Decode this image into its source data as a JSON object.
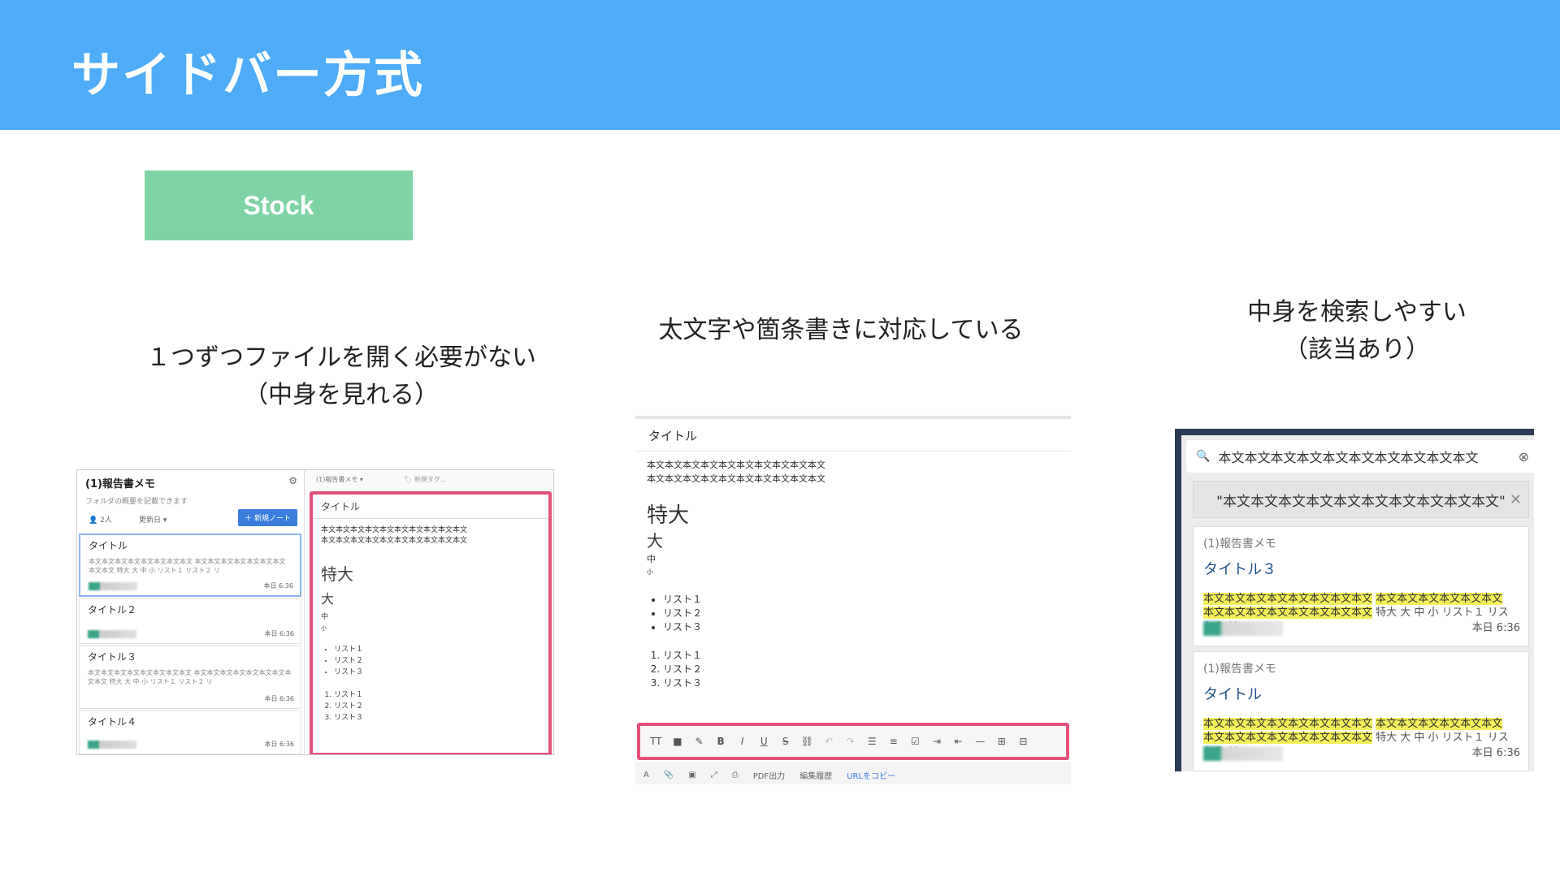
{
  "header": {
    "title": "サイドバー方式"
  },
  "stock_label": "Stock",
  "captions": {
    "c1_line1": "１つずつファイルを開く必要がない",
    "c1_line2": "（中身を見れる）",
    "c2": "太文字や箇条書きに対応している",
    "c3_line1": "中身を検索しやすい",
    "c3_line2": "（該当あり）"
  },
  "panel1": {
    "folder": "(1)報告書メモ",
    "folder_desc": "フォルダの概要を記載できます",
    "members": "2人",
    "sort": "更新日 ▾",
    "new_note": "＋ 新規ノート",
    "tab": "(1)報告書メモ ▾",
    "tag_placeholder": "新規タグ...",
    "notes": [
      {
        "title": "タイトル",
        "body": "本文本文本文本文本文本文本文本文 本文本文本文本文本文本文本文本文本文 特大 大 中 小 リスト１ リスト２ リ",
        "date": "本日 6:36"
      },
      {
        "title": "タイトル２",
        "body": "",
        "date": "本日 6:36"
      },
      {
        "title": "タイトル３",
        "body": "本文本文本文本文本文本文本文本文 本文本文本文本文本文本文本文本文本文 特大 大 中 小 リスト１ リスト２ リ",
        "date": "本日 6:36"
      },
      {
        "title": "タイトル４",
        "body": "",
        "date": "本日 6:36"
      }
    ],
    "doc": {
      "title": "タイトル",
      "body1": "本文本文本文本文本文本文本文本文本文本文",
      "body2": "本文本文本文本文本文本文本文本文本文本文",
      "xl": "特大",
      "l": "大",
      "m": "中",
      "s": "小",
      "bullets": [
        "リスト１",
        "リスト２",
        "リスト３"
      ],
      "numbered": [
        "リスト１",
        "リスト２",
        "リスト３"
      ]
    }
  },
  "panel2": {
    "title": "タイトル",
    "body1": "本文本文本文本文本文本文本文本文本文本文",
    "body2": "本文本文本文本文本文本文本文本文本文本文",
    "xl": "特大",
    "l": "大",
    "m": "中",
    "s": "小",
    "bullets": [
      "リスト１",
      "リスト２",
      "リスト３"
    ],
    "numbered": [
      "リスト１",
      "リスト２",
      "リスト３"
    ],
    "footer": {
      "pdf": "PDF出力",
      "history": "編集履歴",
      "copy_url": "URLをコピー"
    }
  },
  "panel3": {
    "search_value": "本文本文本文本文本文本文本文本文本文本文",
    "chip": "\"本文本文本文本文本文本文本文本文本文本文\"",
    "results": [
      {
        "folder": "(1)報告書メモ",
        "title": "タイトル３",
        "hl1": "本文本文本文本文本文本文本文本文",
        "hl2": "本文本文本文本文本文本文",
        "hl3": "本文本文本文本文本文本文本文本文",
        "rest": " 特大 大 中 小 リスト１ リスト２ リ",
        "date": "本日 6:36"
      },
      {
        "folder": "(1)報告書メモ",
        "title": "タイトル",
        "hl1": "本文本文本文本文本文本文本文本文",
        "hl2": "本文本文本文本文本文本文",
        "hl3": "本文本文本文本文本文本文本文本文",
        "rest": " 特大 大 中 小 リスト１ リスト２ リ",
        "date": "本日 6:36"
      }
    ]
  },
  "colors": {
    "header": "#4dabf7",
    "stock": "#7fd3a4",
    "highlight_border": "#e2507a",
    "search_highlight": "#f5f05a"
  }
}
